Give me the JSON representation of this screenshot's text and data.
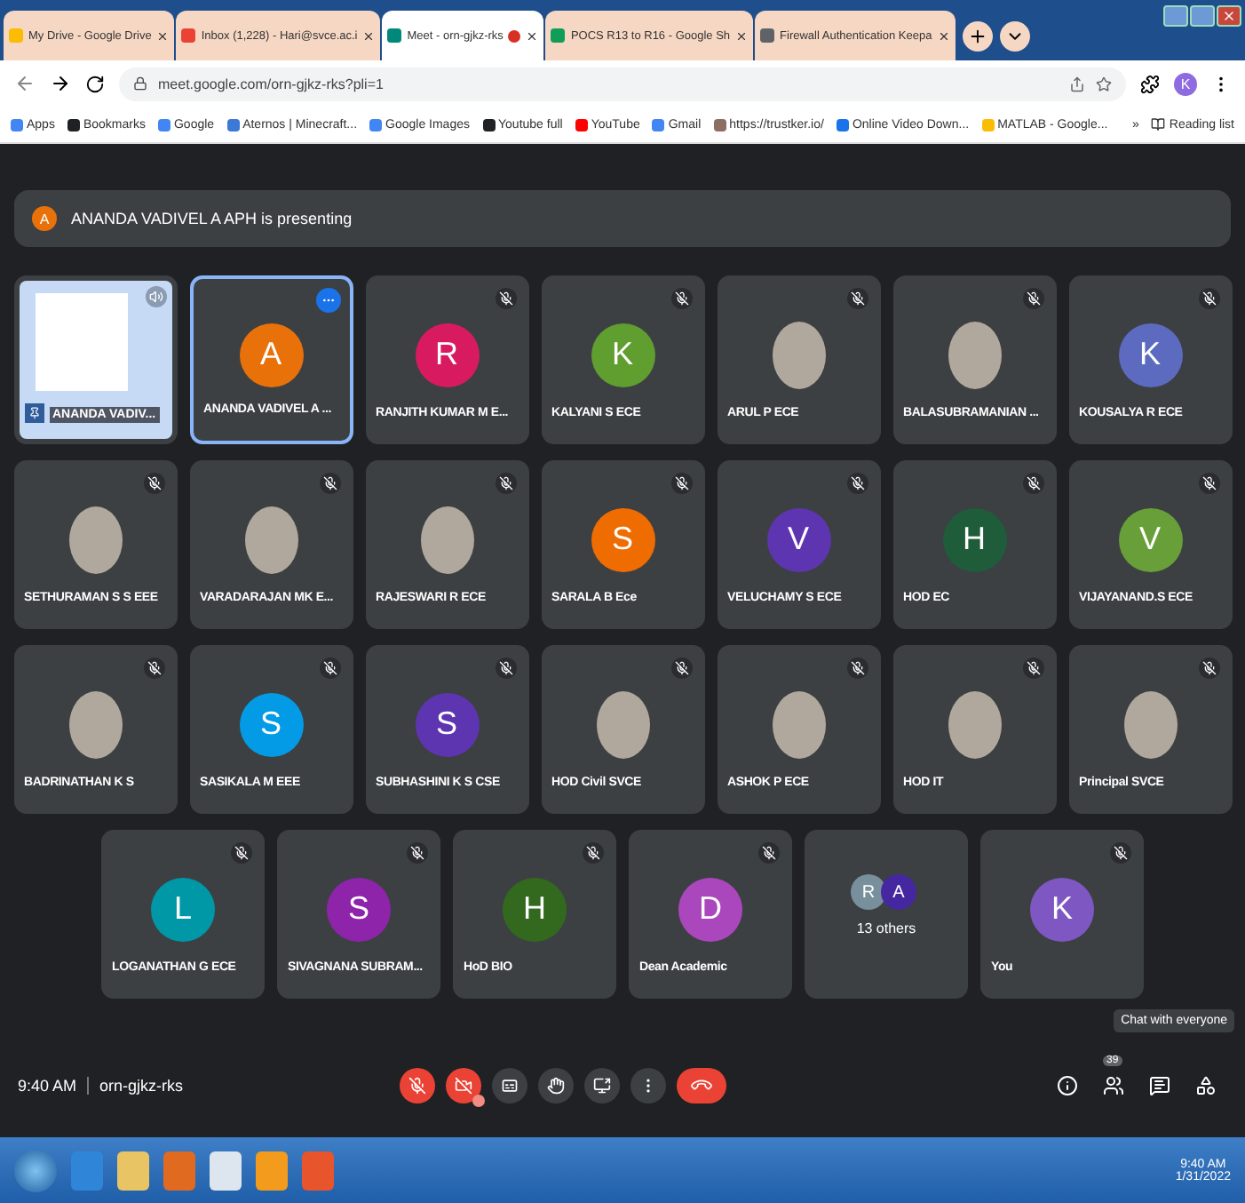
{
  "browser": {
    "tabs": [
      {
        "title": "My Drive - Google Drive",
        "selected": false,
        "color": "#fbbc04",
        "recording": false
      },
      {
        "title": "Inbox (1,228) - Hari@svce.ac.i",
        "selected": false,
        "color": "#ea4335",
        "recording": false
      },
      {
        "title": "Meet - orn-gjkz-rks",
        "selected": true,
        "color": "#00897b",
        "recording": true
      },
      {
        "title": "POCS R13 to R16 - Google Sh",
        "selected": false,
        "color": "#0f9d58",
        "recording": false
      },
      {
        "title": "Firewall Authentication Keepa",
        "selected": false,
        "color": "#5f6368",
        "recording": false
      }
    ],
    "url": "meet.google.com/orn-gjkz-rks?pli=1",
    "profile_letter": "K",
    "bookmarks": [
      {
        "label": "Apps",
        "color": "#4285f4"
      },
      {
        "label": "Bookmarks",
        "color": "#202124"
      },
      {
        "label": "Google",
        "color": "#4285f4"
      },
      {
        "label": "Aternos | Minecraft...",
        "color": "#3b78d8"
      },
      {
        "label": "Google Images",
        "color": "#4285f4"
      },
      {
        "label": "Youtube full",
        "color": "#202124"
      },
      {
        "label": "YouTube",
        "color": "#ff0000"
      },
      {
        "label": "Gmail",
        "color": "#4285f4"
      },
      {
        "label": "https://trustker.io/",
        "color": "#8d6e63"
      },
      {
        "label": "Online Video Down...",
        "color": "#1a73e8"
      },
      {
        "label": "MATLAB - Google...",
        "color": "#fbbc04"
      }
    ],
    "more_bookmarks": "»",
    "reading_list": "Reading list"
  },
  "meet": {
    "presenting": {
      "avatar_letter": "A",
      "text": "ANANDA VADIVEL A APH is presenting"
    },
    "tile_rows": [
      [
        {
          "kind": "screen",
          "name": "ANANDA VADIV...",
          "speaking": false,
          "muted": false
        },
        {
          "kind": "letter",
          "letter": "A",
          "color": "#e8710a",
          "name": "ANANDA VADIVEL A ...",
          "speaking": true,
          "muted": false
        },
        {
          "kind": "letter",
          "letter": "R",
          "color": "#d81b60",
          "name": "RANJITH KUMAR M E...",
          "speaking": false,
          "muted": true
        },
        {
          "kind": "letter",
          "letter": "K",
          "color": "#5f9e2f",
          "name": "KALYANI S ECE",
          "speaking": false,
          "muted": true
        },
        {
          "kind": "photo",
          "name": "ARUL P ECE",
          "speaking": false,
          "muted": true
        },
        {
          "kind": "photo",
          "name": "BALASUBRAMANIAN ...",
          "speaking": false,
          "muted": true
        },
        {
          "kind": "letter",
          "letter": "K",
          "color": "#5c6bc0",
          "name": "KOUSALYA R ECE",
          "speaking": false,
          "muted": true
        }
      ],
      [
        {
          "kind": "photo",
          "name": "SETHURAMAN S S EEE",
          "speaking": false,
          "muted": true
        },
        {
          "kind": "photo",
          "name": "VARADARAJAN MK E...",
          "speaking": false,
          "muted": true
        },
        {
          "kind": "photo",
          "name": "RAJESWARI R ECE",
          "speaking": false,
          "muted": true
        },
        {
          "kind": "letter",
          "letter": "S",
          "color": "#ef6c00",
          "name": "SARALA B Ece",
          "speaking": false,
          "muted": true
        },
        {
          "kind": "letter",
          "letter": "V",
          "color": "#5e35b1",
          "name": "VELUCHAMY S ECE",
          "speaking": false,
          "muted": true
        },
        {
          "kind": "letter",
          "letter": "H",
          "color": "#1e5c3a",
          "name": "HOD EC",
          "speaking": false,
          "muted": true
        },
        {
          "kind": "letter",
          "letter": "V",
          "color": "#689f38",
          "name": "VIJAYANAND.S ECE",
          "speaking": false,
          "muted": true
        }
      ],
      [
        {
          "kind": "photo",
          "name": "BADRINATHAN K S",
          "speaking": false,
          "muted": true
        },
        {
          "kind": "letter",
          "letter": "S",
          "color": "#039be5",
          "name": "SASIKALA M EEE",
          "speaking": false,
          "muted": true
        },
        {
          "kind": "letter",
          "letter": "S",
          "color": "#5e35b1",
          "name": "SUBHASHINI K S CSE",
          "speaking": false,
          "muted": true
        },
        {
          "kind": "photo",
          "name": "HOD Civil SVCE",
          "speaking": false,
          "muted": true
        },
        {
          "kind": "photo",
          "name": "ASHOK P ECE",
          "speaking": false,
          "muted": true
        },
        {
          "kind": "photo",
          "name": "HOD IT",
          "speaking": false,
          "muted": true
        },
        {
          "kind": "photo",
          "name": "Principal SVCE",
          "speaking": false,
          "muted": true
        }
      ],
      [
        {
          "kind": "letter",
          "letter": "L",
          "color": "#0097a7",
          "name": "LOGANATHAN G ECE",
          "speaking": false,
          "muted": true
        },
        {
          "kind": "letter",
          "letter": "S",
          "color": "#8e24aa",
          "name": "SIVAGNANA SUBRAM...",
          "speaking": false,
          "muted": true
        },
        {
          "kind": "letter",
          "letter": "H",
          "color": "#33691e",
          "name": "HoD BIO",
          "speaking": false,
          "muted": true
        },
        {
          "kind": "letter",
          "letter": "D",
          "color": "#ab47bc",
          "name": "Dean Academic",
          "speaking": false,
          "muted": true
        },
        {
          "kind": "others",
          "name": "13 others",
          "speaking": false,
          "avatars": [
            {
              "letter": "R",
              "color": "#78909c"
            },
            {
              "letter": "A",
              "color": "#4527a0"
            }
          ]
        },
        {
          "kind": "letter",
          "letter": "K",
          "color": "#7e57c2",
          "name": "You",
          "speaking": false,
          "muted": true
        }
      ]
    ],
    "time": "9:40 AM",
    "meeting_code": "orn-gjkz-rks",
    "controls": [
      {
        "kind": "mic",
        "on": false
      },
      {
        "kind": "camera",
        "on": false
      },
      {
        "kind": "captions",
        "on": false
      },
      {
        "kind": "hand",
        "on": false
      },
      {
        "kind": "present",
        "on": false
      },
      {
        "kind": "more"
      },
      {
        "kind": "leave"
      }
    ],
    "side_controls": [
      {
        "kind": "info"
      },
      {
        "kind": "people",
        "badge": "39"
      },
      {
        "kind": "chat"
      },
      {
        "kind": "activities"
      }
    ],
    "tooltip": "Chat with everyone"
  },
  "taskbar": {
    "time": "9:40 AM",
    "date": "1/31/2022"
  }
}
